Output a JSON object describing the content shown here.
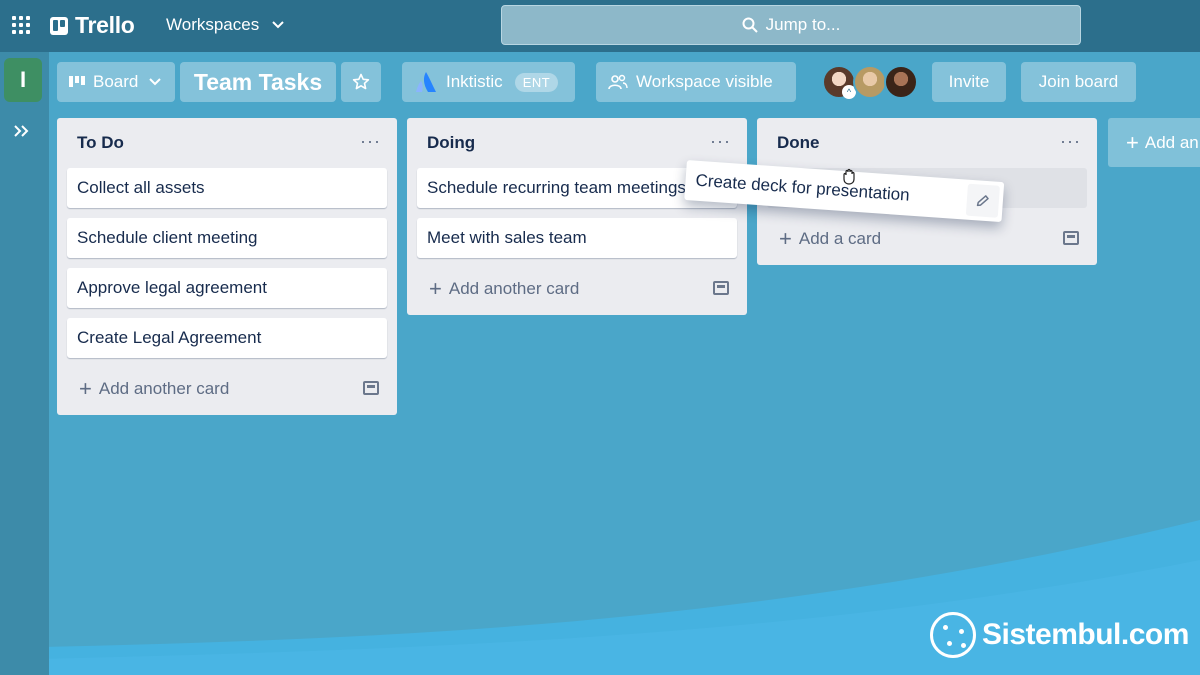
{
  "topnav": {
    "apps_icon": "grid-icon",
    "logo_text": "Trello",
    "workspaces_label": "Workspaces",
    "search_placeholder": "Jump to..."
  },
  "sidebar": {
    "workspace_initial": "I",
    "expand_icon": "double-chevron-right-icon"
  },
  "board_header": {
    "view_label": "Board",
    "board_title": "Team Tasks",
    "org_name": "Inktistic",
    "org_badge": "ENT",
    "visibility_label": "Workspace visible",
    "invite_label": "Invite",
    "join_label": "Join board"
  },
  "lists": [
    {
      "title": "To Do",
      "cards": [
        "Collect all assets",
        "Schedule client meeting",
        "Approve legal agreement",
        "Create Legal Agreement"
      ],
      "add_label": "Add another card"
    },
    {
      "title": "Doing",
      "cards": [
        "Schedule recurring team meetings",
        "Meet with sales team"
      ],
      "add_label": "Add another card"
    },
    {
      "title": "Done",
      "cards": [],
      "add_label": "Add a card"
    }
  ],
  "dragging_card": "Create deck for presentation",
  "add_list_label": "Add an",
  "watermark": "Sistembul.com",
  "colors": {
    "topnav": "#2c6f8c",
    "board_bg": "#4aa6c9",
    "list_bg": "#ebecf0",
    "workspace_avatar": "#3e8f63"
  }
}
